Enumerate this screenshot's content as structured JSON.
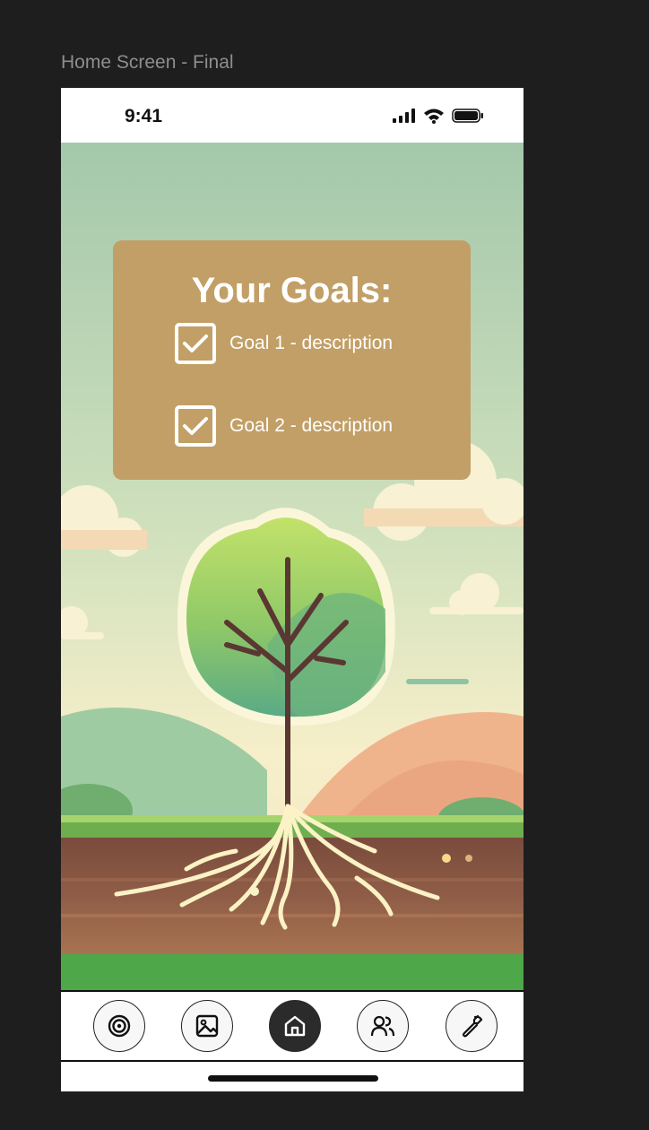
{
  "frame": {
    "label": "Home Screen - Final"
  },
  "status_bar": {
    "time": "9:41",
    "icons": [
      "cellular-signal-icon",
      "wifi-icon",
      "battery-icon"
    ]
  },
  "goals": {
    "title": "Your Goals:",
    "items": [
      {
        "label": "Goal 1 - description",
        "checked": true
      },
      {
        "label": "Goal 2 - description",
        "checked": true
      }
    ]
  },
  "scene": {
    "description_icon": "tree-with-roots-illustration"
  },
  "tab_bar": {
    "items": [
      {
        "name": "goals",
        "icon": "target-icon",
        "active": false
      },
      {
        "name": "gallery",
        "icon": "image-icon",
        "active": false
      },
      {
        "name": "home",
        "icon": "home-icon",
        "active": true
      },
      {
        "name": "community",
        "icon": "users-icon",
        "active": false
      },
      {
        "name": "settings",
        "icon": "wrench-icon",
        "active": false
      }
    ]
  },
  "colors": {
    "canvas": "#1e1e1e",
    "goals_card": "#c29f66",
    "active_tab": "#2b2b2b",
    "sky_top": "#a6c9ac",
    "sky_bottom": "#f3ecc6",
    "soil": "#8a5a44",
    "grass": "#4ea748"
  }
}
